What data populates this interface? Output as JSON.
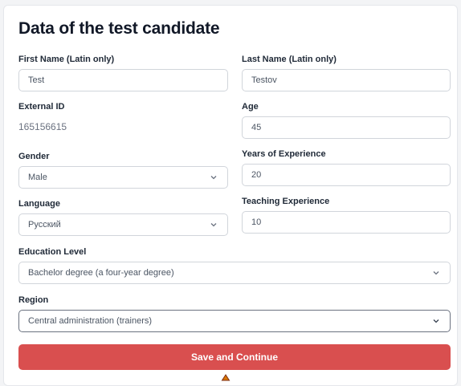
{
  "form": {
    "title": "Data of the test candidate",
    "first_name": {
      "label": "First Name (Latin only)",
      "value": "Test"
    },
    "last_name": {
      "label": "Last Name (Latin only)",
      "value": "Testov"
    },
    "external_id": {
      "label": "External ID",
      "value": "165156615"
    },
    "age": {
      "label": "Age",
      "value": "45"
    },
    "gender": {
      "label": "Gender",
      "value": "Male"
    },
    "years_experience": {
      "label": "Years of Experience",
      "value": "20"
    },
    "language": {
      "label": "Language",
      "value": "Русский"
    },
    "teaching_experience": {
      "label": "Teaching Experience",
      "value": "10"
    },
    "education_level": {
      "label": "Education Level",
      "value": "Bachelor degree (a four-year degree)"
    },
    "region": {
      "label": "Region",
      "value": "Central administration (trainers)"
    },
    "submit_label": "Save and Continue"
  },
  "colors": {
    "accent": "#d94f4f",
    "border": "#d1d5db",
    "focused_border": "#6b7280"
  },
  "icons": {
    "dropdown": "chevron-down-icon"
  }
}
